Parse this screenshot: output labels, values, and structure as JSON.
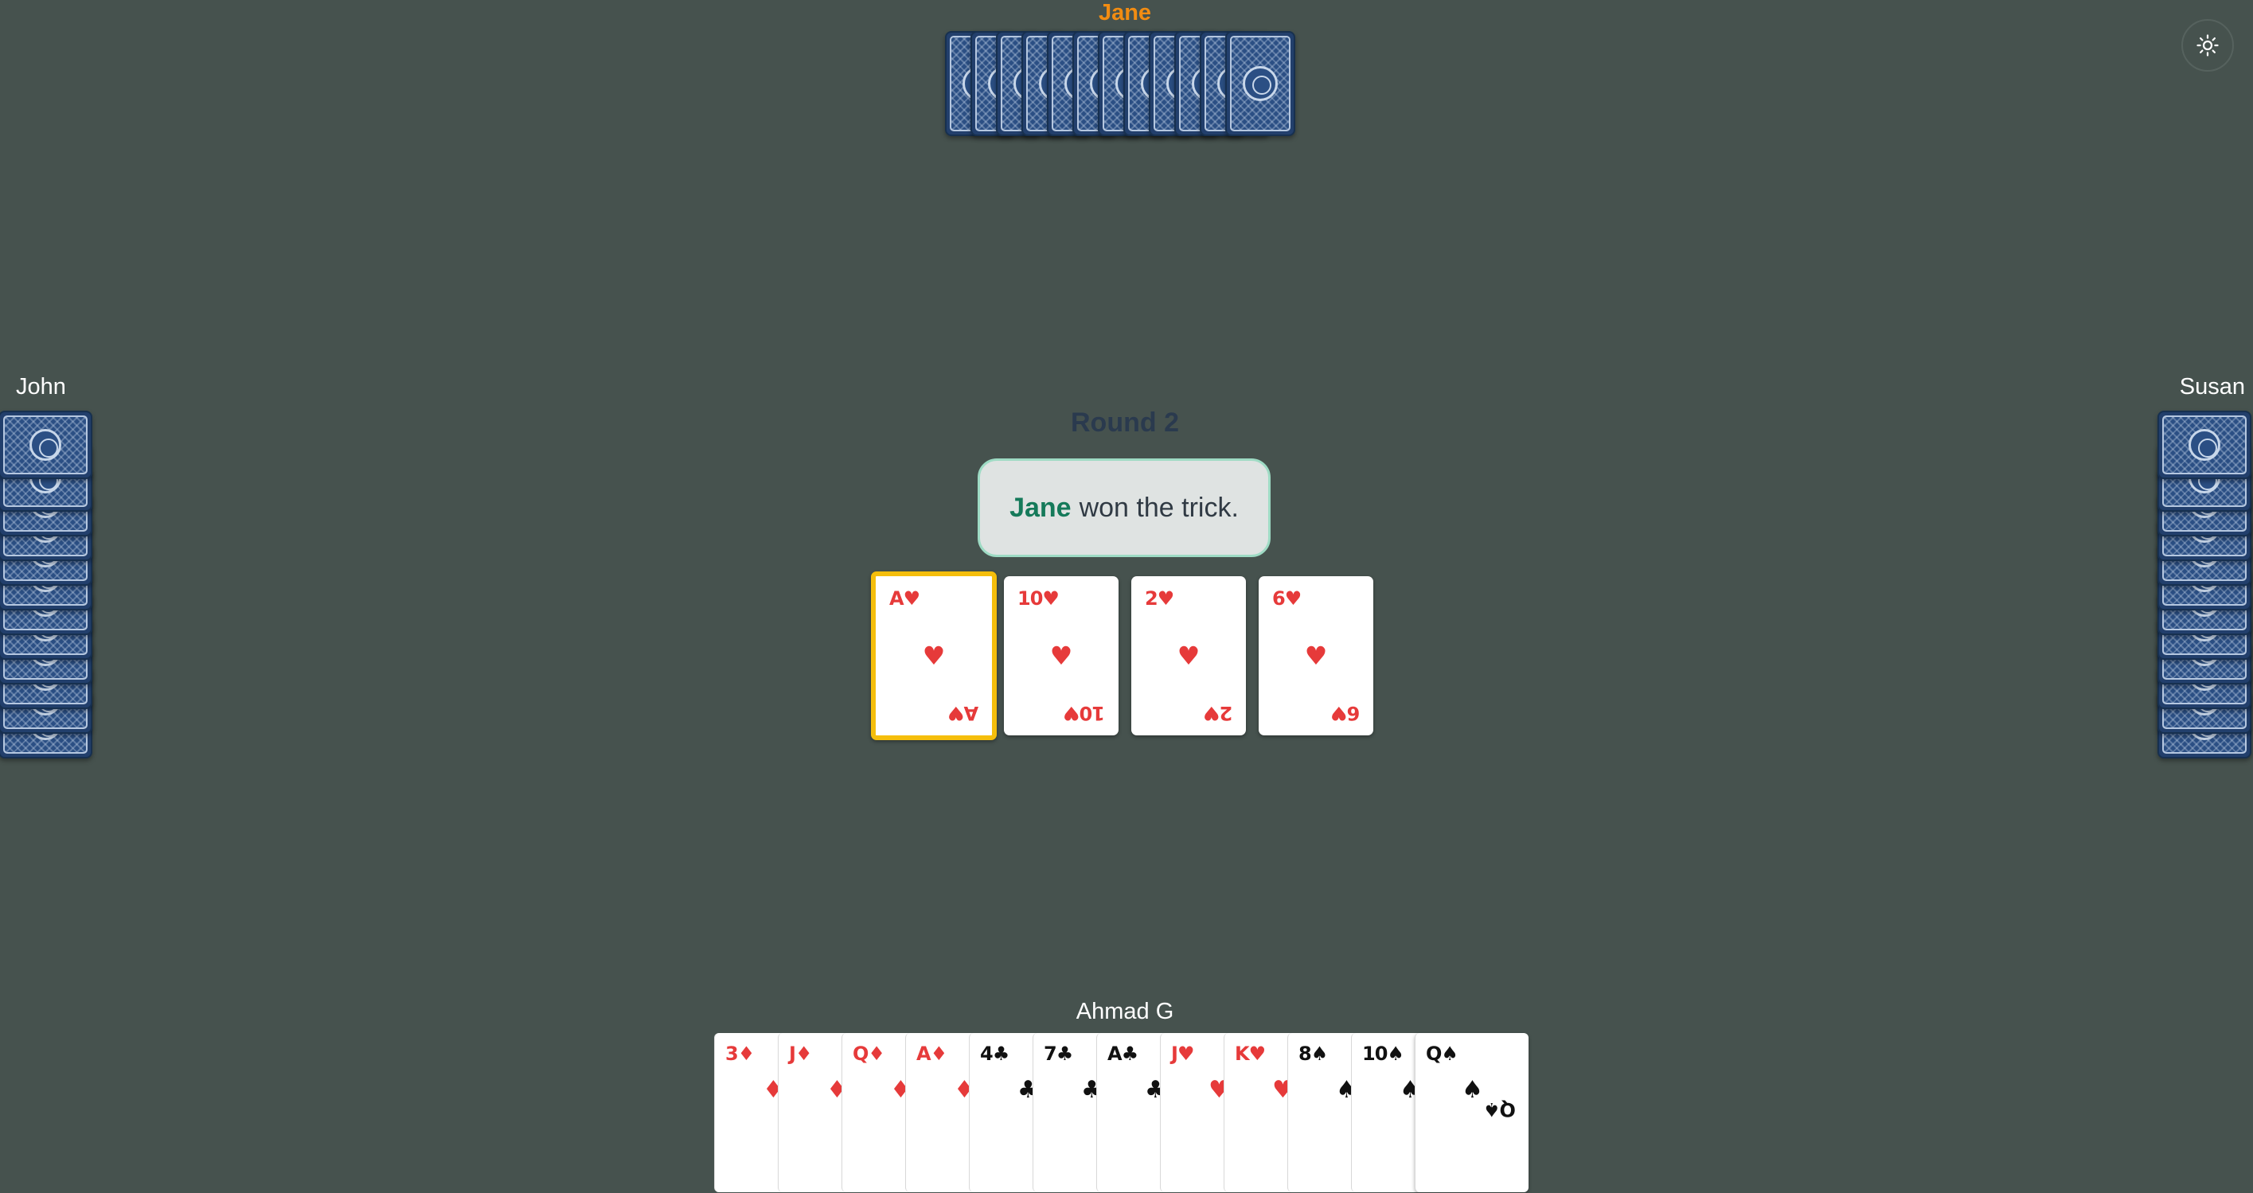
{
  "players": {
    "north": {
      "name": "Jane",
      "cards_in_hand": 12
    },
    "west": {
      "name": "John",
      "cards_in_hand": 12
    },
    "east": {
      "name": "Susan",
      "cards_in_hand": 12
    },
    "south": {
      "name": "Ahmad G"
    }
  },
  "round": {
    "label": "Round 2"
  },
  "message": {
    "winner": "Jane",
    "text": "won the trick."
  },
  "trick": [
    {
      "rank": "A",
      "suit": "♥",
      "color": "red",
      "winner": true
    },
    {
      "rank": "10",
      "suit": "♥",
      "color": "red",
      "winner": false
    },
    {
      "rank": "2",
      "suit": "♥",
      "color": "red",
      "winner": false
    },
    {
      "rank": "6",
      "suit": "♥",
      "color": "red",
      "winner": false
    }
  ],
  "hand": [
    {
      "rank": "3",
      "suit": "♦",
      "color": "red"
    },
    {
      "rank": "J",
      "suit": "♦",
      "color": "red"
    },
    {
      "rank": "Q",
      "suit": "♦",
      "color": "red"
    },
    {
      "rank": "A",
      "suit": "♦",
      "color": "red"
    },
    {
      "rank": "4",
      "suit": "♣",
      "color": "black"
    },
    {
      "rank": "7",
      "suit": "♣",
      "color": "black"
    },
    {
      "rank": "A",
      "suit": "♣",
      "color": "black"
    },
    {
      "rank": "J",
      "suit": "♥",
      "color": "red"
    },
    {
      "rank": "K",
      "suit": "♥",
      "color": "red"
    },
    {
      "rank": "8",
      "suit": "♠",
      "color": "black"
    },
    {
      "rank": "10",
      "suit": "♠",
      "color": "black"
    },
    {
      "rank": "Q",
      "suit": "♠",
      "color": "black"
    }
  ],
  "controls": {
    "theme_toggle_icon": "sun-icon"
  },
  "colors": {
    "table": "#46524e",
    "north_name": "#f28c12",
    "red_suit": "#e63a3a",
    "winner_highlight": "#f5be0b",
    "card_back": "#2b4f84",
    "message_bg": "#dfe3e2",
    "message_winner": "#157a5a"
  }
}
